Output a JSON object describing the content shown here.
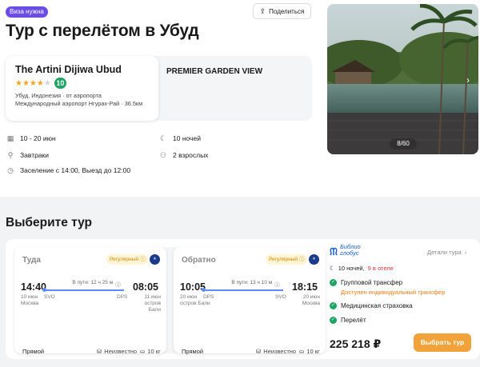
{
  "header": {
    "visa_badge": "Виза нужна",
    "share_label": "Поделиться",
    "title": "Тур с перелётом в Убуд"
  },
  "hotel": {
    "name": "The Artini Dijiwa Ubud",
    "stars_filled": 4,
    "stars_total": 5,
    "score": "10",
    "location_line1": "Убуд, Индонезия · от аэропорта",
    "location_line2": "Международный аэропорт Нгурах-Рай · 36.5км",
    "room_name": "PREMIER GARDEN VIEW"
  },
  "details": {
    "dates": "10 - 20 июн",
    "nights": "10 ночей",
    "meals": "Завтраки",
    "guests": "2 взрослых",
    "checkin": "Заселение с 14:00, Выезд до 12:00"
  },
  "gallery": {
    "counter": "8/60"
  },
  "tours": {
    "section_title": "Выберите тур",
    "outbound": {
      "title": "Туда",
      "badge": "Регулярный",
      "airline_icon": "airline-logo-icon",
      "dep_time": "14:40",
      "dep_date": "10 июн",
      "dep_city": "Москва",
      "dep_code": "SVO",
      "duration": "В пути: 12 ч 25 м",
      "arr_time": "08:05",
      "arr_date": "11 июн",
      "arr_city": "остров Бали",
      "arr_code": "DPS",
      "type": "Прямой",
      "baggage_status": "Неизвестно",
      "cabin_bag": "10 кг"
    },
    "inbound": {
      "title": "Обратно",
      "badge": "Регулярный",
      "airline_icon": "airline-logo-icon",
      "dep_time": "10:05",
      "dep_date": "20 июн",
      "dep_city": "остров Бали",
      "dep_code": "DPS",
      "duration": "В пути: 13 ч 10 м",
      "arr_time": "18:15",
      "arr_date": "20 июн",
      "arr_city": "Москва",
      "arr_code": "SVO",
      "type": "Прямой",
      "baggage_status": "Неизвестно",
      "cabin_bag": "10 кг"
    },
    "operator": {
      "logo_line1": "Библио",
      "logo_line2": "глобус"
    },
    "details_link": "Детали тура",
    "nights": "10 ночей,",
    "nights_highlight": "9 в отеле",
    "features": [
      "Групповой трансфер",
      "Медицинская страховка",
      "Перелёт"
    ],
    "transfer_note": "Доступен индивидуальный трансфер",
    "price": "225 218 ₽",
    "choose_label": "Выбрать тур"
  },
  "colors": {
    "accent_orange": "#f2a23a",
    "score_green": "#1fa463",
    "visa_purple": "#6b4de6",
    "highlight_red": "#d8373a"
  }
}
